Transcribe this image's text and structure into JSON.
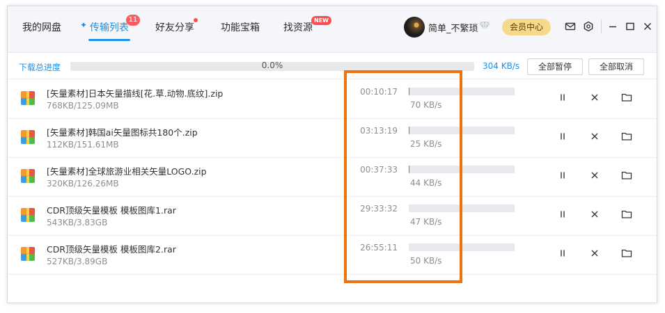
{
  "nav": {
    "tabs": [
      {
        "label": "我的网盘"
      },
      {
        "label": "传输列表",
        "badge": "11"
      },
      {
        "label": "好友分享"
      },
      {
        "label": "功能宝箱"
      },
      {
        "label": "找资源",
        "badge": "NEW"
      }
    ]
  },
  "user": {
    "name": "简单_不繁琐",
    "vip_label": "会员中心"
  },
  "icons": [
    "mail-icon",
    "settings-icon",
    "minimize-icon",
    "maximize-icon",
    "close-icon"
  ],
  "colors": {
    "accent": "#1e8fe6",
    "highlight": "#f0720f",
    "badge": "#ff4d4f",
    "vip": "#f7d98b"
  },
  "progress": {
    "label": "下载总进度",
    "percent_text": "0.0%",
    "percent": 0,
    "total_speed": "304 KB/s",
    "pause_all": "全部暂停",
    "cancel_all": "全部取消"
  },
  "downloads": [
    {
      "name": "[矢量素材]日本矢量描线[花.草.动物.底纹].zip",
      "size": "768KB/125.09MB",
      "time_left": "00:10:17",
      "speed": "70 KB/s",
      "progress": 0.006
    },
    {
      "name": "[矢量素材]韩国ai矢量图标共180个.zip",
      "size": "112KB/151.61MB",
      "time_left": "03:13:19",
      "speed": "25 KB/s",
      "progress": 0.001
    },
    {
      "name": "[矢量素材]全球旅游业相关矢量LOGO.zip",
      "size": "320KB/126.26MB",
      "time_left": "00:37:33",
      "speed": "44 KB/s",
      "progress": 0.0025
    },
    {
      "name": "CDR顶级矢量模板 模板图库1.rar",
      "size": "543KB/3.83GB",
      "time_left": "29:33:32",
      "speed": "47 KB/s",
      "progress": 0.0001
    },
    {
      "name": "CDR顶级矢量模板 模板图库2.rar",
      "size": "527KB/3.89GB",
      "time_left": "26:55:11",
      "speed": "50 KB/s",
      "progress": 0.0001
    }
  ]
}
